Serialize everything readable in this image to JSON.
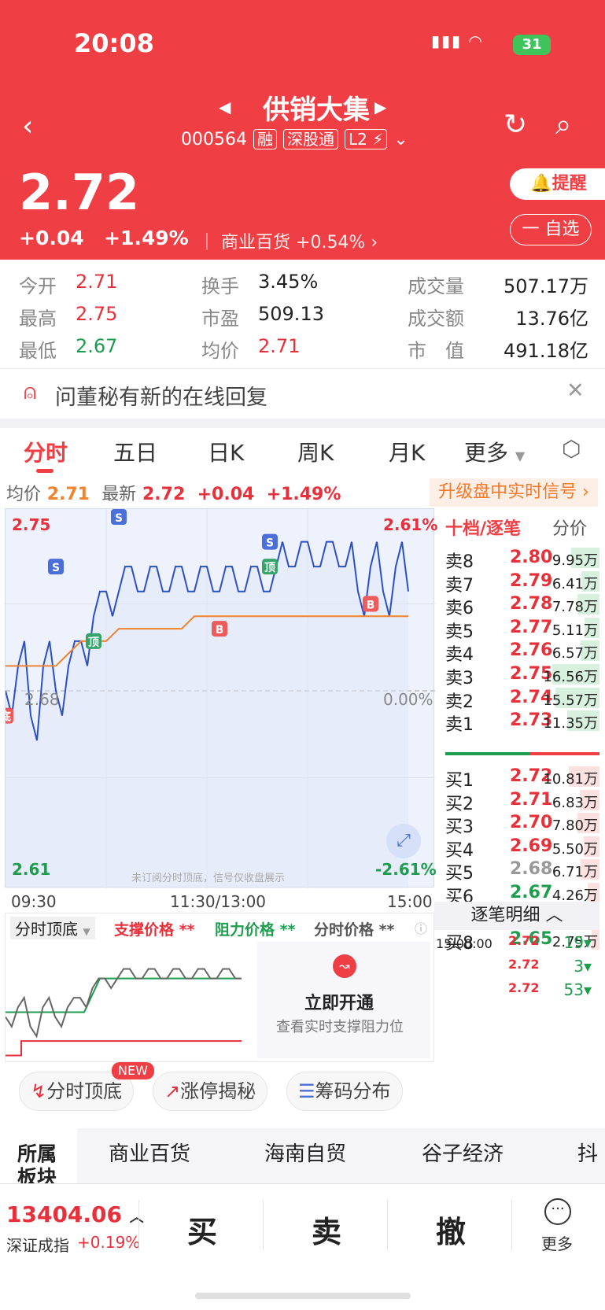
{
  "status": {
    "time": "20:08",
    "battery": "31"
  },
  "stock": {
    "name": "供销大集",
    "code": "000564",
    "tags": [
      "融",
      "深股通",
      "L2"
    ],
    "price": "2.72",
    "change": "+0.04",
    "change_pct": "+1.49%",
    "industry": "商业百货",
    "industry_pct": "+0.54%",
    "alert_label": "提醒",
    "watch_label": "一 自选"
  },
  "quote": {
    "open_k": "今开",
    "open": "2.71",
    "high_k": "最高",
    "high": "2.75",
    "low_k": "最低",
    "low": "2.67",
    "turnover_k": "换手",
    "turnover": "3.45%",
    "pe_k": "市盈",
    "pe": "509.13",
    "avg_k": "均价",
    "avg": "2.71",
    "vol_k": "成交量",
    "vol": "507.17万",
    "amt_k": "成交额",
    "amt": "13.76亿",
    "cap_k": "市　值",
    "cap": "491.18亿"
  },
  "notice": "问董秘有新的在线回复",
  "tabs": [
    "分时",
    "五日",
    "日K",
    "周K",
    "月K",
    "更多"
  ],
  "info": {
    "avg_k": "均价",
    "avg": "2.71",
    "last_k": "最新",
    "last": "2.72",
    "chg": "+0.04",
    "pct": "+1.49%",
    "upgrade": "升级盘中实时信号"
  },
  "chart_data": {
    "type": "line",
    "ylim": [
      2.61,
      2.75
    ],
    "ref_price": "2.68",
    "y_top_left": "2.75",
    "y_top_right": "2.61%",
    "y_mid_right": "0.00%",
    "y_mid_left": "2.68",
    "y_bot_left": "2.61",
    "y_bot_right": "-2.61%",
    "x_ticks": [
      "09:30",
      "11:30/13:00",
      "15:00"
    ],
    "watermark": "未订阅分时顶底，信号仅收盘展示",
    "marker_labels": [
      "S",
      "S",
      "S",
      "B",
      "B",
      "顶",
      "顶",
      "底"
    ],
    "series": [
      {
        "values": [
          2.68,
          2.69,
          2.67,
          2.69,
          2.68,
          2.69,
          2.7,
          2.71,
          2.72,
          2.72,
          2.73,
          2.72,
          2.73,
          2.72,
          2.73,
          2.72,
          2.73,
          2.72,
          2.73,
          2.72,
          2.73,
          2.72,
          2.74,
          2.73,
          2.74,
          2.73,
          2.74,
          2.73,
          2.72,
          2.73,
          2.72,
          2.73,
          2.72
        ]
      },
      {
        "values": [
          2.69,
          2.69,
          2.69,
          2.69,
          2.69,
          2.695,
          2.7,
          2.7,
          2.7,
          2.705,
          2.705,
          2.705,
          2.705,
          2.705,
          2.705,
          2.71,
          2.71,
          2.71,
          2.71,
          2.71,
          2.71,
          2.71,
          2.71,
          2.71,
          2.71,
          2.71,
          2.71,
          2.71,
          2.71,
          2.71,
          2.71,
          2.71,
          2.71
        ]
      }
    ]
  },
  "orderbook": {
    "title": "十档/逐笔",
    "col": "分价",
    "asks": [
      {
        "l": "卖8",
        "p": "2.80",
        "v": "9.95万"
      },
      {
        "l": "卖7",
        "p": "2.79",
        "v": "6.41万"
      },
      {
        "l": "卖6",
        "p": "2.78",
        "v": "7.78万"
      },
      {
        "l": "卖5",
        "p": "2.77",
        "v": "5.11万"
      },
      {
        "l": "卖4",
        "p": "2.76",
        "v": "6.57万"
      },
      {
        "l": "卖3",
        "p": "2.75",
        "v": "16.56万"
      },
      {
        "l": "卖2",
        "p": "2.74",
        "v": "15.57万"
      },
      {
        "l": "卖1",
        "p": "2.73",
        "v": "11.35万"
      }
    ],
    "bids": [
      {
        "l": "买1",
        "p": "2.72",
        "v": "10.81万"
      },
      {
        "l": "买2",
        "p": "2.71",
        "v": "6.83万"
      },
      {
        "l": "买3",
        "p": "2.70",
        "v": "7.80万"
      },
      {
        "l": "买4",
        "p": "2.69",
        "v": "5.50万"
      },
      {
        "l": "买5",
        "p": "2.68",
        "v": "6.71万"
      },
      {
        "l": "买6",
        "p": "2.67",
        "v": "4.26万"
      },
      {
        "l": "买7",
        "p": "2.66",
        "v": "5.37万"
      },
      {
        "l": "买8",
        "p": "2.65",
        "v": "2.75万"
      }
    ],
    "trades_title": "逐笔明细",
    "trades": [
      {
        "t": "15:00:00",
        "p": "2.72",
        "v": "19"
      },
      {
        "t": "",
        "p": "2.72",
        "v": "3"
      },
      {
        "t": "",
        "p": "2.72",
        "v": "53"
      }
    ]
  },
  "indicator": {
    "name": "分时顶底",
    "support": "支撑价格 **",
    "resist": "阻力价格 **",
    "price": "分时价格 **",
    "cta": "立即开通",
    "cta_sub": "查看实时支撑阻力位"
  },
  "chips": [
    {
      "label": "分时顶底",
      "badge": "NEW"
    },
    {
      "label": "涨停揭秘"
    },
    {
      "label": "筹码分布"
    }
  ],
  "sectors": {
    "title": "所属板块",
    "items": [
      "商业百货",
      "海南自贸",
      "谷子经济",
      "抖"
    ]
  },
  "footer": {
    "index_val": "13404.06",
    "index_name": "深证成指",
    "index_pct": "+0.19%",
    "buy": "买",
    "sell": "卖",
    "cancel": "撤",
    "more": "更多"
  }
}
